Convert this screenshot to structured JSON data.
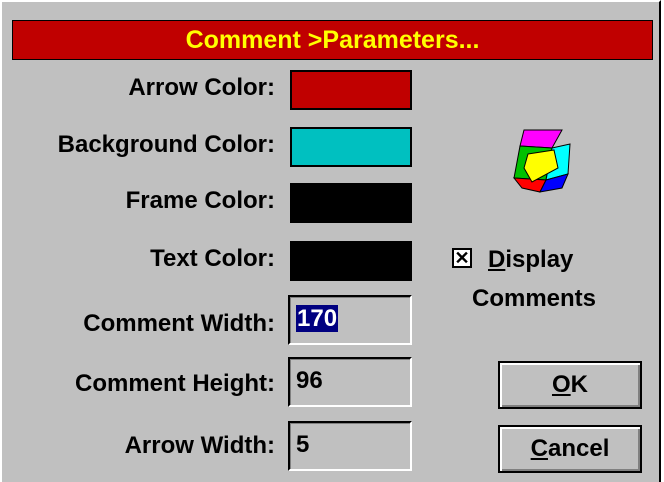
{
  "dialog": {
    "title": "Comment >Parameters...",
    "labels": {
      "arrow_color": "Arrow Color:",
      "background_color": "Background Color:",
      "frame_color": "Frame Color:",
      "text_color": "Text Color:",
      "comment_width": "Comment Width:",
      "comment_height": "Comment Height:",
      "arrow_width": "Arrow Width:"
    },
    "colors": {
      "arrow_color": "#c00000",
      "background_color": "#00c0c0",
      "frame_color": "#000000",
      "text_color": "#000000"
    },
    "values": {
      "comment_width": "170",
      "comment_height": "96",
      "arrow_width": "5"
    },
    "checkbox": {
      "checked": true,
      "mark": "✕",
      "label_line1_mnemonic": "D",
      "label_line1_rest": "isplay",
      "label_line2": "Comments"
    },
    "buttons": {
      "ok_mnemonic": "O",
      "ok_rest": "K",
      "cancel_mnemonic": "C",
      "cancel_rest": "ancel"
    },
    "icon": "comment-parameters-icon"
  }
}
